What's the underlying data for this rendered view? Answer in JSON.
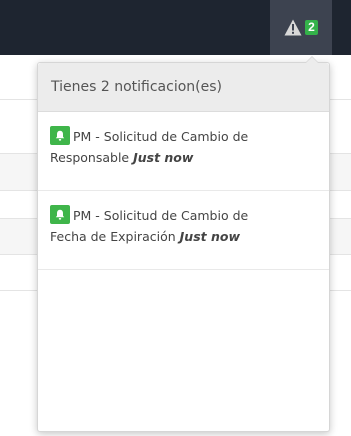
{
  "topbar": {
    "alert_count": "2",
    "icon": "warning-triangle-icon"
  },
  "dropdown": {
    "header": "Tienes 2 notificacion(es)",
    "notifications": [
      {
        "icon": "bell-icon",
        "line1": "PM - Solicitud de Cambio de",
        "line2": "Responsable",
        "time": "Just now"
      },
      {
        "icon": "bell-icon",
        "line1": "PM - Solicitud de Cambio de",
        "line2": "Fecha de Expiración",
        "time": "Just now"
      }
    ]
  },
  "colors": {
    "topbar": "#1e2530",
    "badge": "#34b24a",
    "bell": "#3fb54a",
    "header_bg": "#ececec"
  }
}
